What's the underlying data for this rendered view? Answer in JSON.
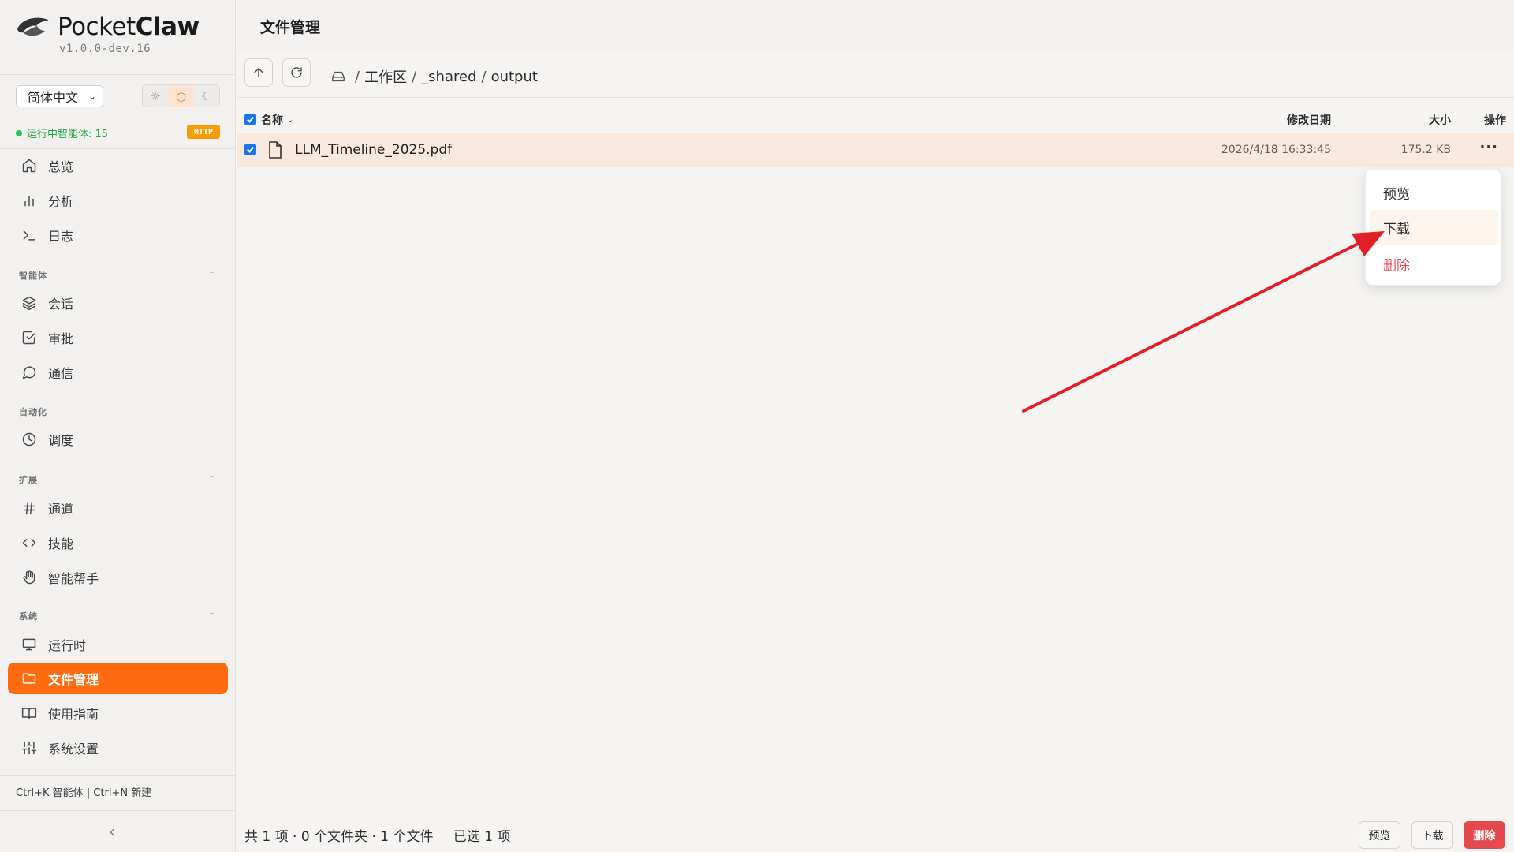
{
  "app": {
    "name_light": "Pocket",
    "name_bold": "Claw",
    "version": "v1.0.0-dev.16"
  },
  "sidebar": {
    "language": "简体中文",
    "theme_icons": [
      "sun-icon",
      "circle-icon",
      "moon-icon"
    ],
    "agent_status": "运行中智能体: 15",
    "protocol_badge": "HTTP",
    "top_items": [
      {
        "label": "总览",
        "icon": "home-icon"
      },
      {
        "label": "分析",
        "icon": "bar-chart-icon"
      },
      {
        "label": "日志",
        "icon": "terminal-icon"
      }
    ],
    "sections": [
      {
        "title": "智能体",
        "items": [
          {
            "label": "会话",
            "icon": "layers-icon"
          },
          {
            "label": "审批",
            "icon": "check-square-icon"
          },
          {
            "label": "通信",
            "icon": "message-icon"
          }
        ]
      },
      {
        "title": "自动化",
        "items": [
          {
            "label": "调度",
            "icon": "clock-icon"
          }
        ]
      },
      {
        "title": "扩展",
        "items": [
          {
            "label": "通道",
            "icon": "hash-icon"
          },
          {
            "label": "技能",
            "icon": "code-icon"
          },
          {
            "label": "智能帮手",
            "icon": "hand-icon"
          }
        ]
      },
      {
        "title": "系统",
        "items": [
          {
            "label": "运行时",
            "icon": "monitor-icon"
          },
          {
            "label": "文件管理",
            "icon": "folder-icon",
            "active": true
          },
          {
            "label": "使用指南",
            "icon": "book-icon"
          },
          {
            "label": "系统设置",
            "icon": "sliders-icon"
          }
        ]
      }
    ],
    "shortcuts": "Ctrl+K 智能体 | Ctrl+N 新建"
  },
  "main": {
    "title": "文件管理",
    "breadcrumb": [
      "工作区",
      "_shared",
      "output"
    ],
    "columns": {
      "name": "名称",
      "modified": "修改日期",
      "size": "大小",
      "actions": "操作"
    },
    "files": [
      {
        "name": "LLM_Timeline_2025.pdf",
        "modified": "2026/4/18 16:33:45",
        "size": "175.2 KB",
        "selected": true
      }
    ],
    "context_menu": [
      "预览",
      "下载",
      "删除"
    ],
    "footer": {
      "summary": "共 1 项 · 0 个文件夹 · 1 个文件",
      "selected": "已选 1 项"
    },
    "footer_buttons": {
      "preview": "预览",
      "download": "下载",
      "delete": "删除"
    }
  },
  "colors": {
    "accent": "#ff6b0f",
    "danger": "#e5484d",
    "annotation_arrow": "#e02027"
  }
}
